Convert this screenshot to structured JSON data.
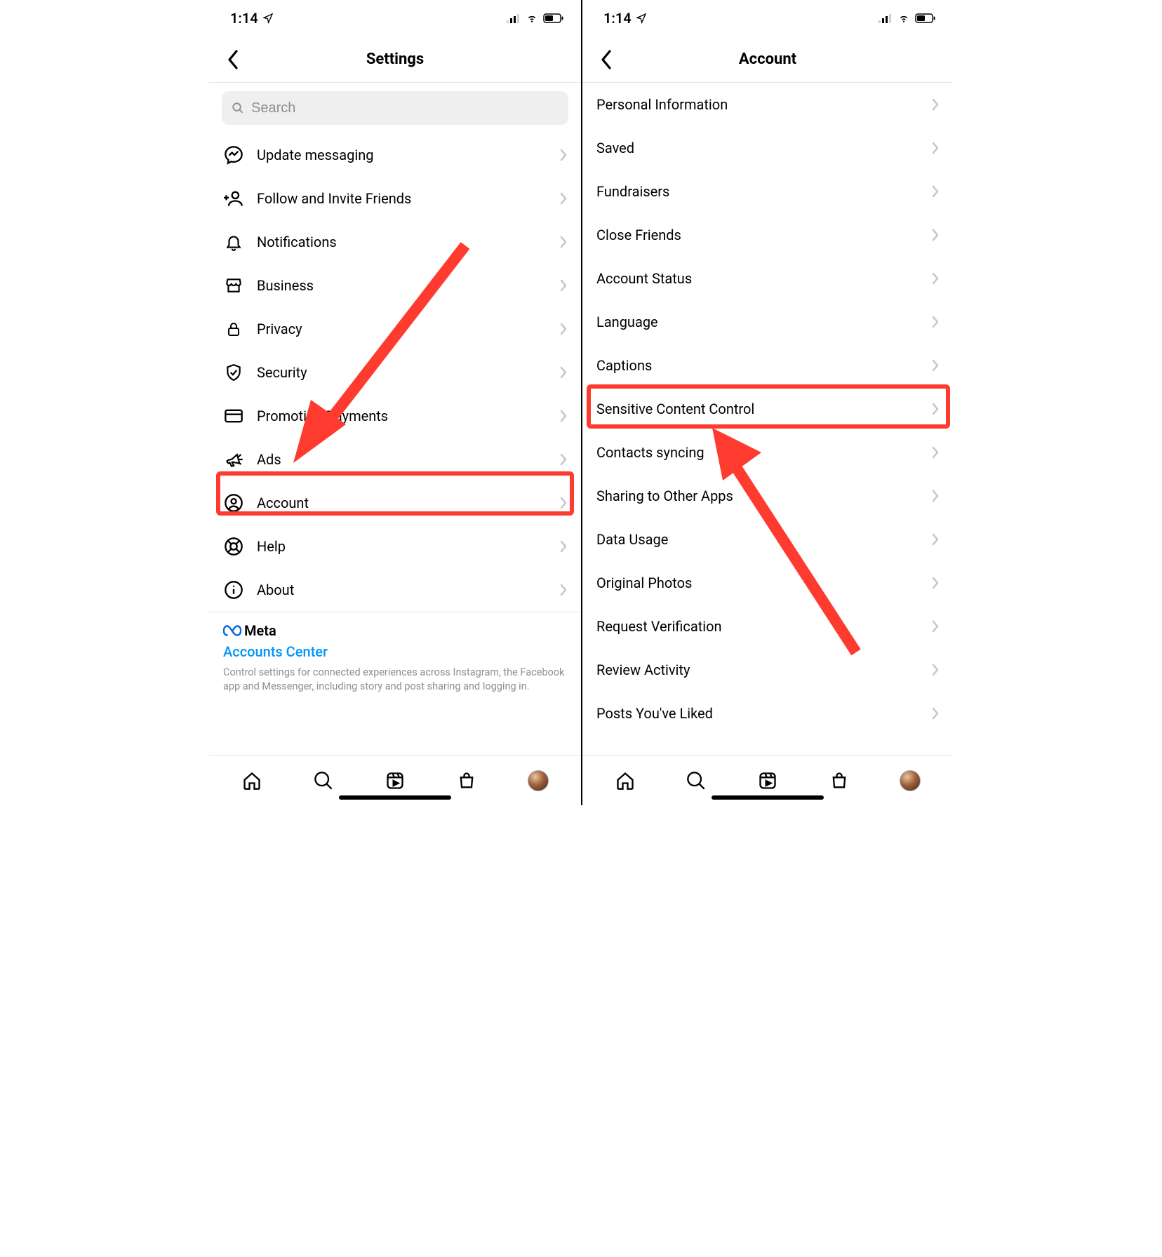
{
  "status": {
    "time": "1:14",
    "location_icon": "location-arrow",
    "signal_icon": "cell-signal",
    "wifi_icon": "wifi",
    "battery_icon": "battery-half"
  },
  "left": {
    "title": "Settings",
    "search_placeholder": "Search",
    "items": [
      {
        "icon": "messenger-icon",
        "label": "Update messaging"
      },
      {
        "icon": "add-friend-icon",
        "label": "Follow and Invite Friends"
      },
      {
        "icon": "bell-icon",
        "label": "Notifications"
      },
      {
        "icon": "storefront-icon",
        "label": "Business"
      },
      {
        "icon": "lock-icon",
        "label": "Privacy"
      },
      {
        "icon": "shield-check-icon",
        "label": "Security"
      },
      {
        "icon": "credit-card-icon",
        "label": "Promotion Payments"
      },
      {
        "icon": "megaphone-icon",
        "label": "Ads"
      },
      {
        "icon": "user-circle-icon",
        "label": "Account"
      },
      {
        "icon": "lifebuoy-icon",
        "label": "Help"
      },
      {
        "icon": "info-icon",
        "label": "About"
      }
    ],
    "meta_brand": "Meta",
    "accounts_center": "Accounts Center",
    "footer_desc": "Control settings for connected experiences across Instagram, the Facebook app and Messenger, including story and post sharing and logging in."
  },
  "right": {
    "title": "Account",
    "items": [
      {
        "label": "Personal Information"
      },
      {
        "label": "Saved"
      },
      {
        "label": "Fundraisers"
      },
      {
        "label": "Close Friends"
      },
      {
        "label": "Account Status"
      },
      {
        "label": "Language"
      },
      {
        "label": "Captions"
      },
      {
        "label": "Sensitive Content Control"
      },
      {
        "label": "Contacts syncing"
      },
      {
        "label": "Sharing to Other Apps"
      },
      {
        "label": "Data Usage"
      },
      {
        "label": "Original Photos"
      },
      {
        "label": "Request Verification"
      },
      {
        "label": "Review Activity"
      },
      {
        "label": "Posts You've Liked"
      }
    ]
  },
  "annotations": {
    "left_highlight_item_index": 8,
    "right_highlight_item_index": 7
  }
}
